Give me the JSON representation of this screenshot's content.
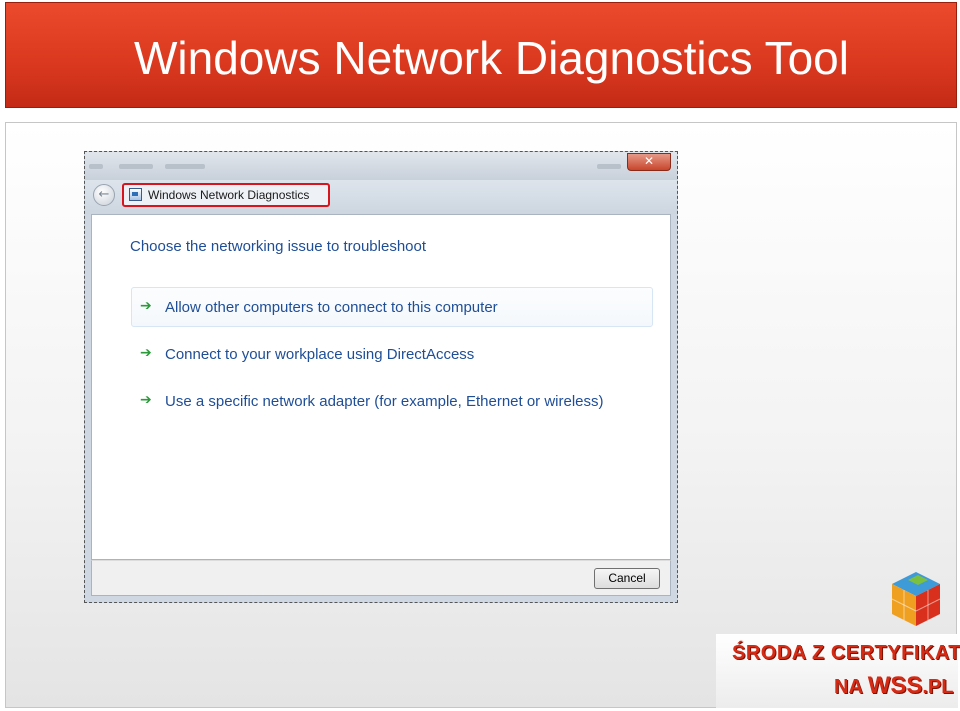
{
  "slide": {
    "title": "Windows Network Diagnostics Tool"
  },
  "window": {
    "close_glyph": "✕",
    "back_glyph": "←",
    "breadcrumb": "Windows Network Diagnostics",
    "heading": "Choose the networking issue to troubleshoot",
    "options": [
      {
        "label": "Allow other computers to connect to this computer",
        "icon": "green-arrow-icon",
        "highlighted": true
      },
      {
        "label": "Connect to your workplace using DirectAccess",
        "icon": "green-arrow-icon",
        "highlighted": false
      },
      {
        "label": "Use a specific network adapter (for example, Ethernet or wireless)",
        "icon": "green-arrow-icon",
        "highlighted": false
      }
    ],
    "arrow_glyph": "➔",
    "cancel_label": "Cancel"
  },
  "brand": {
    "line1": "ŚRODA Z CERTYFIKATEM",
    "line2_prefix": "NA ",
    "line2_main": "WSS",
    "line2_suffix": ".PL"
  },
  "colors": {
    "title_red": "#dc3a20",
    "link_blue": "#1f4e96",
    "highlight_border": "#d8141c",
    "arrow_green": "#2c9a3a",
    "brand_red": "#d52a14"
  }
}
